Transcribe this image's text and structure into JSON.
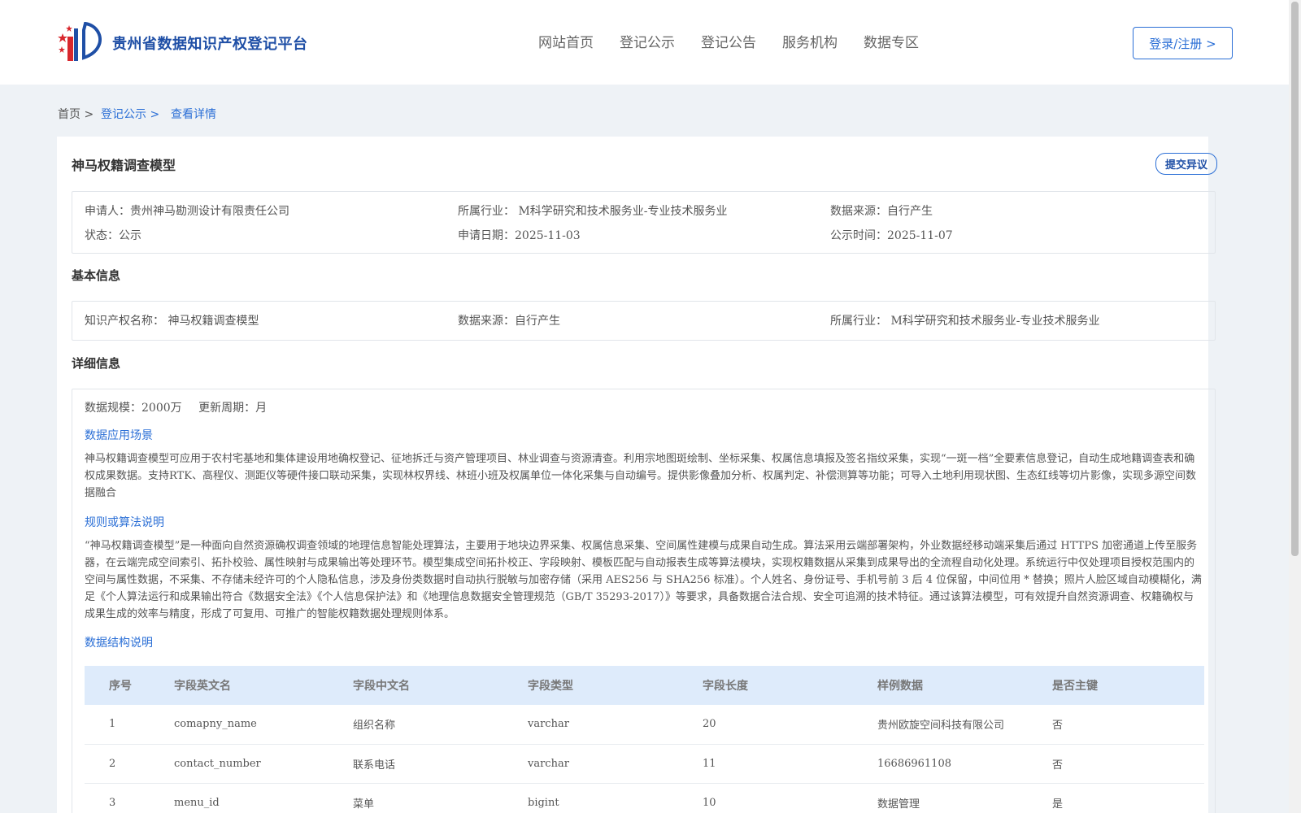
{
  "header": {
    "site_title": "贵州省数据知识产权登记平台",
    "nav": [
      "网站首页",
      "登记公示",
      "登记公告",
      "服务机构",
      "数据专区"
    ],
    "login_label": "登录/注册 >"
  },
  "breadcrumb": {
    "home": "首页 >",
    "registry": "登记公示 >",
    "current": "查看详情"
  },
  "detail": {
    "title": "神马权籍调查模型",
    "objection_label": "提交异议",
    "summary": {
      "applicant_label": "申请人：",
      "applicant": "贵州神马勘测设计有限责任公司",
      "industry_label": "所属行业：",
      "industry": "M科学研究和技术服务业-专业技术服务业",
      "source_label": "数据来源：",
      "source": "自行产生",
      "status_label": "状态：",
      "status": "公示",
      "apply_date_label": "申请日期：",
      "apply_date": "2025-11-03",
      "publish_date_label": "公示时间：",
      "publish_date": "2025-11-07"
    },
    "basic": {
      "section_title": "基本信息",
      "ip_name_label": "知识产权名称：",
      "ip_name": "神马权籍调查模型",
      "source_label": "数据来源：",
      "source": "自行产生",
      "industry_label": "所属行业：",
      "industry": "M科学研究和技术服务业-专业技术服务业"
    },
    "details": {
      "section_title": "详细信息",
      "scale_label": "数据规模：",
      "scale": "2000万",
      "cycle_label": "更新周期：",
      "cycle": "月",
      "scenario_title": "数据应用场景",
      "scenario_text": "神马权籍调查模型可应用于农村宅基地和集体建设用地确权登记、征地拆迁与资产管理项目、林业调查与资源清查。利用宗地图斑绘制、坐标采集、权属信息填报及签名指纹采集，实现“一斑一档”全要素信息登记，自动生成地籍调查表和确权成果数据。支持RTK、高程仪、测距仪等硬件接口联动采集，实现林权界线、林班小班及权属单位一体化采集与自动编号。提供影像叠加分析、权属判定、补偿测算等功能；可导入土地利用现状图、生态红线等切片影像，实现多源空间数据融合",
      "rules_title": "规则或算法说明",
      "rules_text": "“神马权籍调查模型”是一种面向自然资源确权调查领域的地理信息智能处理算法，主要用于地块边界采集、权属信息采集、空间属性建模与成果自动生成。算法采用云端部署架构，外业数据经移动端采集后通过 HTTPS 加密通道上传至服务器，在云端完成空间索引、拓扑校验、属性映射与成果输出等处理环节。模型集成空间拓扑校正、字段映射、模板匹配与自动报表生成等算法模块，实现权籍数据从采集到成果导出的全流程自动化处理。系统运行中仅处理项目授权范围内的空间与属性数据，不采集、不存储未经许可的个人隐私信息，涉及身份类数据时自动执行脱敏与加密存储（采用 AES256 与 SHA256 标准）。个人姓名、身份证号、手机号前 3 后 4 位保留，中间位用 * 替换；照片人脸区域自动模糊化，满足《个人算法运行和成果输出符合《数据安全法》《个人信息保护法》和《地理信息数据安全管理规范（GB/T 35293-2017）》等要求，具备数据合法合规、安全可追溯的技术特征。通过该算法模型，可有效提升自然资源调查、权籍确权与成果生成的效率与精度，形成了可复用、可推广的智能权籍数据处理规则体系。",
      "structure_title": "数据结构说明",
      "table": {
        "headers": [
          "序号",
          "字段英文名",
          "字段中文名",
          "字段类型",
          "字段长度",
          "样例数据",
          "是否主键"
        ],
        "rows": [
          [
            "1",
            "comapny_name",
            "组织名称",
            "varchar",
            "20",
            "贵州欧旋空间科技有限公司",
            "否"
          ],
          [
            "2",
            "contact_number",
            "联系电话",
            "varchar",
            "11",
            "16686961108",
            "否"
          ],
          [
            "3",
            "menu_id",
            "菜单",
            "bigint",
            "10",
            "数据管理",
            "是"
          ]
        ]
      }
    }
  },
  "colors": {
    "accent": "#2b6fd6",
    "brand": "#1f4fa6",
    "table_header_bg": "#deebfb",
    "page_bg": "#eef2f6"
  },
  "icons": {
    "logo": "flag-logo-icon"
  }
}
